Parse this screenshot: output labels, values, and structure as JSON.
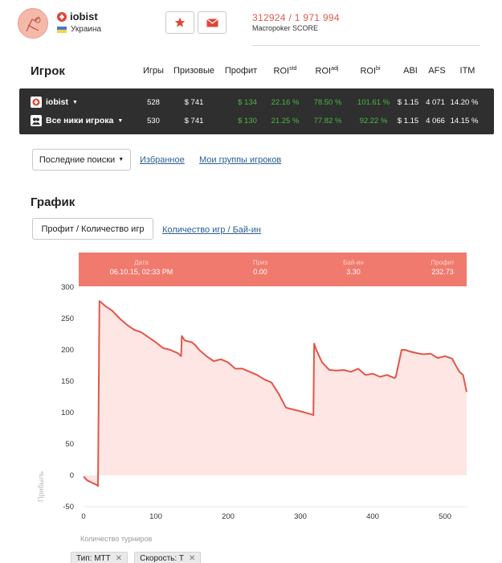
{
  "header": {
    "player_name": "iobist",
    "country": "Украина",
    "score_value": "312924 / 1 971 994",
    "score_label": "Macropoker SCORE"
  },
  "player_table": {
    "title": "Игрок",
    "columns": [
      "Игры",
      "Призовые",
      "Профит",
      "ROI",
      "ROI",
      "ROI",
      "ABI",
      "AFS",
      "ITM"
    ],
    "roi_superscripts": [
      "std",
      "adj",
      "bi"
    ],
    "rows": [
      {
        "name": "iobist",
        "games": "528",
        "prizes": "$ 741",
        "profit": "$ 134",
        "roi_std": "22.16 %",
        "roi_adj": "78.50 %",
        "roi_bi": "101.61 %",
        "abi": "$ 1.15",
        "afs": "4 071",
        "itm": "14.20 %"
      },
      {
        "name": "Все ники игрока",
        "games": "530",
        "prizes": "$ 741",
        "profit": "$ 130",
        "roi_std": "21.25 %",
        "roi_adj": "77.82 %",
        "roi_bi": "92.22 %",
        "abi": "$ 1.15",
        "afs": "4 066",
        "itm": "14.15 %"
      }
    ]
  },
  "nav": {
    "recent_searches": "Последние поиски",
    "favorites": "Избранное",
    "my_groups": "Мои группы игроков"
  },
  "graph": {
    "title": "График",
    "tab_active": "Профит / Количество игр",
    "tab_link": "Количество игр / Бай-ин",
    "tooltip": {
      "date_label": "Дата",
      "date": "06.10.15, 02:33 PM",
      "prize_label": "Приз",
      "prize": "0.00",
      "buyin_label": "Бай-ин",
      "buyin": "3.30",
      "profit_label": "Профит",
      "profit": "232.73"
    },
    "filters": [
      {
        "label": "Тип: MTT"
      },
      {
        "label": "Скорость: Т"
      }
    ]
  },
  "colors": {
    "accent": "#e05b4e",
    "line": "#e2564a",
    "area": "#fde6e3",
    "dark_panel": "#2f2f2f",
    "positive": "#4ab843",
    "link": "#2a5e94"
  },
  "chart_data": {
    "type": "area",
    "title": "",
    "xlabel": "Количество турниров",
    "ylabel": "Прибыль",
    "xlim": [
      0,
      530
    ],
    "ylim": [
      -50,
      300
    ],
    "x_ticks": [
      0,
      100,
      200,
      300,
      400,
      500
    ],
    "y_ticks": [
      -50,
      0,
      50,
      100,
      150,
      200,
      250,
      300
    ],
    "grid": false,
    "series": [
      {
        "x": [
          0,
          5,
          12,
          18,
          20,
          22,
          30,
          40,
          50,
          60,
          70,
          80,
          90,
          100,
          110,
          120,
          130,
          135,
          136,
          140,
          150,
          155,
          160,
          170,
          180,
          190,
          200,
          210,
          220,
          230,
          240,
          250,
          260,
          270,
          280,
          290,
          300,
          310,
          318,
          319,
          322,
          330,
          340,
          350,
          360,
          370,
          380,
          390,
          400,
          410,
          420,
          430,
          432,
          440,
          445,
          450,
          460,
          470,
          480,
          490,
          500,
          510,
          515,
          520,
          525,
          530
        ],
        "y": [
          -2,
          -8,
          -12,
          -15,
          -17,
          278,
          270,
          262,
          250,
          240,
          232,
          228,
          220,
          212,
          203,
          200,
          195,
          190,
          222,
          215,
          212,
          207,
          200,
          190,
          182,
          185,
          180,
          170,
          170,
          165,
          160,
          153,
          148,
          130,
          108,
          105,
          102,
          99,
          96,
          210,
          200,
          180,
          168,
          167,
          168,
          165,
          170,
          160,
          162,
          157,
          160,
          155,
          157,
          200,
          200,
          198,
          195,
          193,
          194,
          187,
          190,
          186,
          175,
          165,
          160,
          133
        ]
      }
    ]
  }
}
